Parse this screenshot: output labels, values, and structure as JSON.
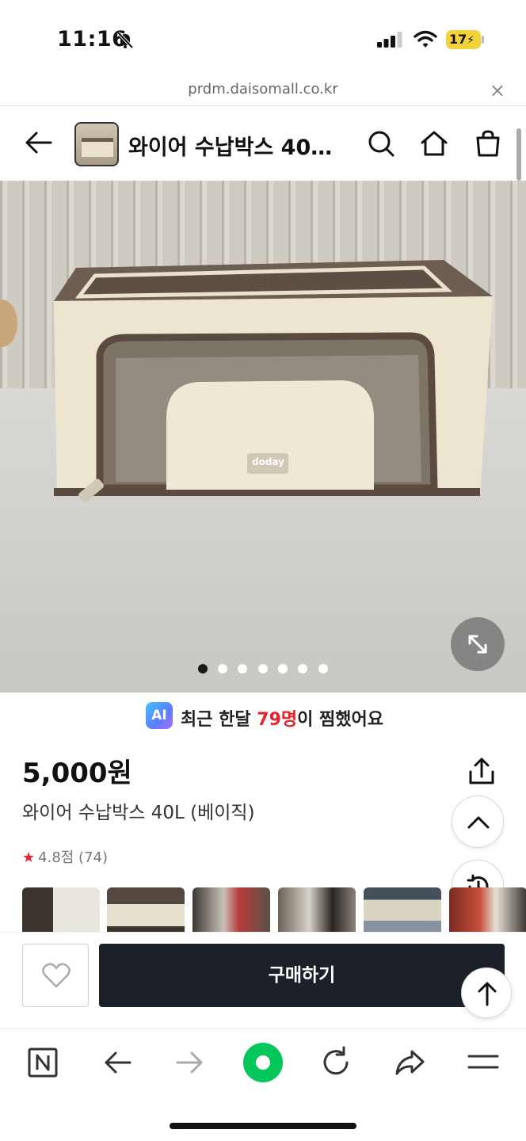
{
  "status_bar": {
    "time": "11:16",
    "battery": "17"
  },
  "url_bar": {
    "url": "prdm.daisomall.co.kr",
    "close_label": "×"
  },
  "header": {
    "title": "와이어 수납박스 40…"
  },
  "gallery": {
    "brand_tag": "doday",
    "slide_count": 7,
    "active_slide": 0
  },
  "ai_banner": {
    "badge": "AI",
    "text_before": "최근 한달 ",
    "count": "79명",
    "text_after": "이 찜했어요"
  },
  "product": {
    "price": "5,000원",
    "name": "와이어 수납박스 40L (베이직)",
    "rating_star": "★",
    "rating_text": "4.8점 (74)"
  },
  "purchase": {
    "buy_label": "구매하기"
  },
  "colors": {
    "accent_red": "#e6222b",
    "buy_button": "#1c2129",
    "naver_green": "#03c75a"
  }
}
